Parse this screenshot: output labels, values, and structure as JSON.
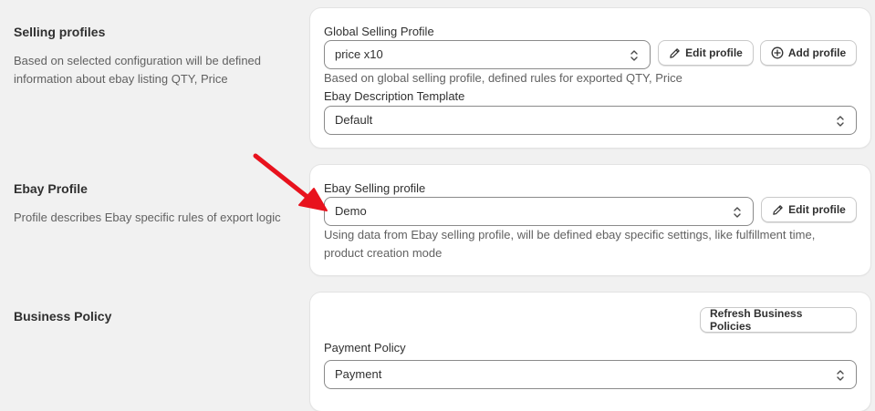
{
  "sections": {
    "selling_profiles": {
      "title": "Selling profiles",
      "description": "Based on selected configuration will be defined information about ebay listing QTY, Price",
      "global_label": "Global Selling Profile",
      "global_value": "price x10",
      "edit_button": "Edit profile",
      "add_button": "Add profile",
      "global_help": "Based on global selling profile, defined rules for exported QTY, Price",
      "template_label": "Ebay Description Template",
      "template_value": "Default"
    },
    "ebay_profile": {
      "title": "Ebay Profile",
      "description": "Profile describes Ebay specific rules of export logic",
      "label": "Ebay Selling profile",
      "value": "Demo",
      "edit_button": "Edit profile",
      "help": "Using data from Ebay selling profile, will be defined ebay specific settings, like fulfillment time, product creation mode"
    },
    "business_policy": {
      "title": "Business Policy",
      "refresh_button": "Refresh Business Policies",
      "payment_label": "Payment Policy",
      "payment_value": "Payment"
    }
  },
  "icons": {
    "edit": "pencil-icon",
    "add": "plus-circle-icon",
    "select": "chevron-up-down-icon",
    "annotation": "red-arrow"
  },
  "colors": {
    "background": "#f1f1f1",
    "card": "#ffffff",
    "annotation_arrow": "#e8121d"
  }
}
